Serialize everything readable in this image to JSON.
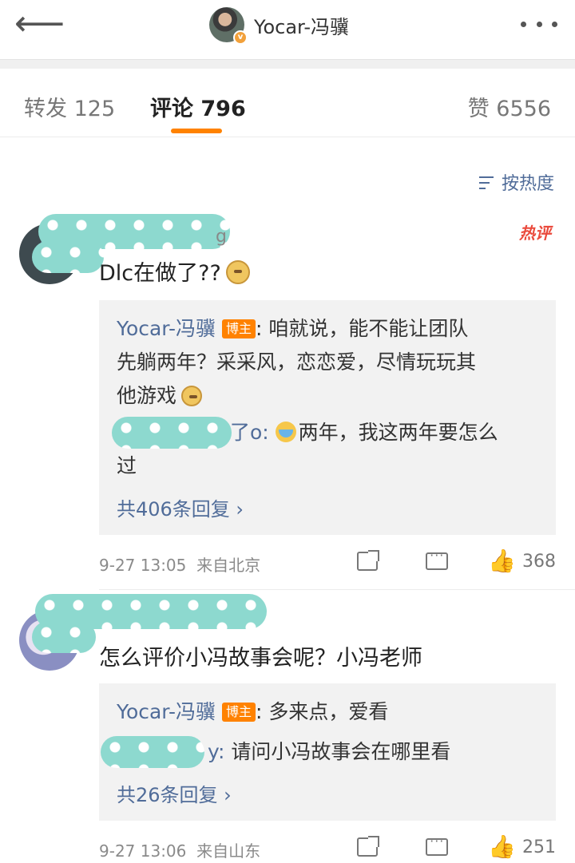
{
  "header": {
    "back_glyph": "⟵",
    "title": "Yocar-冯骥",
    "verified_mark": "v"
  },
  "tabs": {
    "repost": "转发 125",
    "comments": "评论 796",
    "likes": "赞 6556"
  },
  "sort_label": "按热度",
  "comments": [
    {
      "name_tail": "g",
      "hot_badge": "热评",
      "text": "Dlc在做了??",
      "replies": [
        {
          "name": "Yocar-冯骥",
          "badge": "博主",
          "text_l1": ": 咱就说，能不能让团队",
          "text_l2": "先躺两年？采采风，恋恋爱，尽情玩玩其",
          "text_l3": "他游戏"
        },
        {
          "name_tail": "了o:",
          "text_l1": "两年，我这两年要怎么",
          "text_l2": "过"
        }
      ],
      "more": "共406条回复 ›",
      "time": "9-27 13:05",
      "location": "来自北京",
      "like_count": "368"
    },
    {
      "text": "怎么评价小冯故事会呢？小冯老师",
      "replies": [
        {
          "name": "Yocar-冯骥",
          "badge": "博主",
          "text_l1": ": 多来点，爱看"
        },
        {
          "name_tail": "y:",
          "text_l1": "请问小冯故事会在哪里看"
        }
      ],
      "more": "共26条回复 ›",
      "time": "9-27 13:06",
      "location": "来自山东",
      "like_count": "251"
    }
  ],
  "like_glyph": "👍"
}
